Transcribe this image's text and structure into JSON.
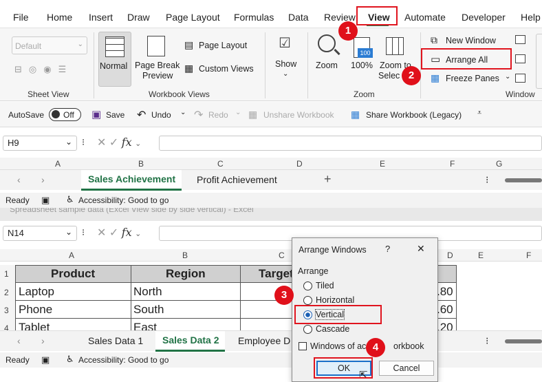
{
  "menu_tabs": [
    "File",
    "Home",
    "Insert",
    "Draw",
    "Page Layout",
    "Formulas",
    "Data",
    "Review",
    "View",
    "Automate",
    "Developer",
    "Help"
  ],
  "ribbon": {
    "style_dropdown": "Default",
    "normal": "Normal",
    "page_break_1": "Page Break",
    "page_break_2": "Preview",
    "page_layout": "Page Layout",
    "custom_views": "Custom Views",
    "show": "Show",
    "zoom": "Zoom",
    "zoom100": "100%",
    "zoom_to_sel_1": "Zoom to",
    "zoom_to_sel_2": "Selec",
    "zoom100_icon_text": "100",
    "new_window": "New Window",
    "arrange_all": "Arrange All",
    "freeze_panes": "Freeze Panes",
    "groups": {
      "sheet_view": "Sheet View",
      "workbook_views": "Workbook Views",
      "zoom": "Zoom",
      "window": "Window"
    }
  },
  "qat": {
    "autosave": "AutoSave",
    "toggle": "Off",
    "save": "Save",
    "undo": "Undo",
    "redo": "Redo",
    "unshare": "Unshare Workbook",
    "share": "Share Workbook (Legacy)"
  },
  "window1": {
    "namebox": "H9",
    "columns": [
      "A",
      "B",
      "C",
      "D",
      "E",
      "F",
      "G"
    ],
    "sheets": [
      "Sales Achievement",
      "Profit Achievement"
    ],
    "status_ready": "Ready",
    "accessibility": "Accessibility: Good to go",
    "title_fragment": "Spreadsheet sample data (Excel View side by side vertical) - Excel"
  },
  "window2": {
    "namebox": "N14",
    "columns": [
      "A",
      "B",
      "C",
      "D",
      "E",
      "F"
    ],
    "row_numbers": [
      "1",
      "2",
      "3",
      "4"
    ],
    "headers": [
      "Product",
      "Region",
      "Target"
    ],
    "rows": [
      {
        "product": "Laptop",
        "region": "North",
        "value": ".80"
      },
      {
        "product": "Phone",
        "region": "South",
        "value": ".60"
      },
      {
        "product": "Tablet",
        "region": "East",
        "value": ".20"
      }
    ],
    "sheets": [
      "Sales Data 1",
      "Sales Data 2",
      "Employee D"
    ],
    "status_ready": "Ready",
    "accessibility": "Accessibility: Good to go"
  },
  "dialog": {
    "title": "Arrange Windows",
    "help": "?",
    "close": "✕",
    "section": "Arrange",
    "options": [
      "Tiled",
      "Horizontal",
      "Vertical",
      "Cascade"
    ],
    "selected": "Vertical",
    "checkbox": "Windows of active workbook",
    "checkbox_visible": "Windows of ac",
    "checkbox_tail": "orkbook",
    "ok": "OK",
    "cancel": "Cancel"
  },
  "callouts": [
    "1",
    "2",
    "3",
    "4"
  ],
  "colors": {
    "accent_red": "#e0101a",
    "excel_green": "#217346"
  }
}
